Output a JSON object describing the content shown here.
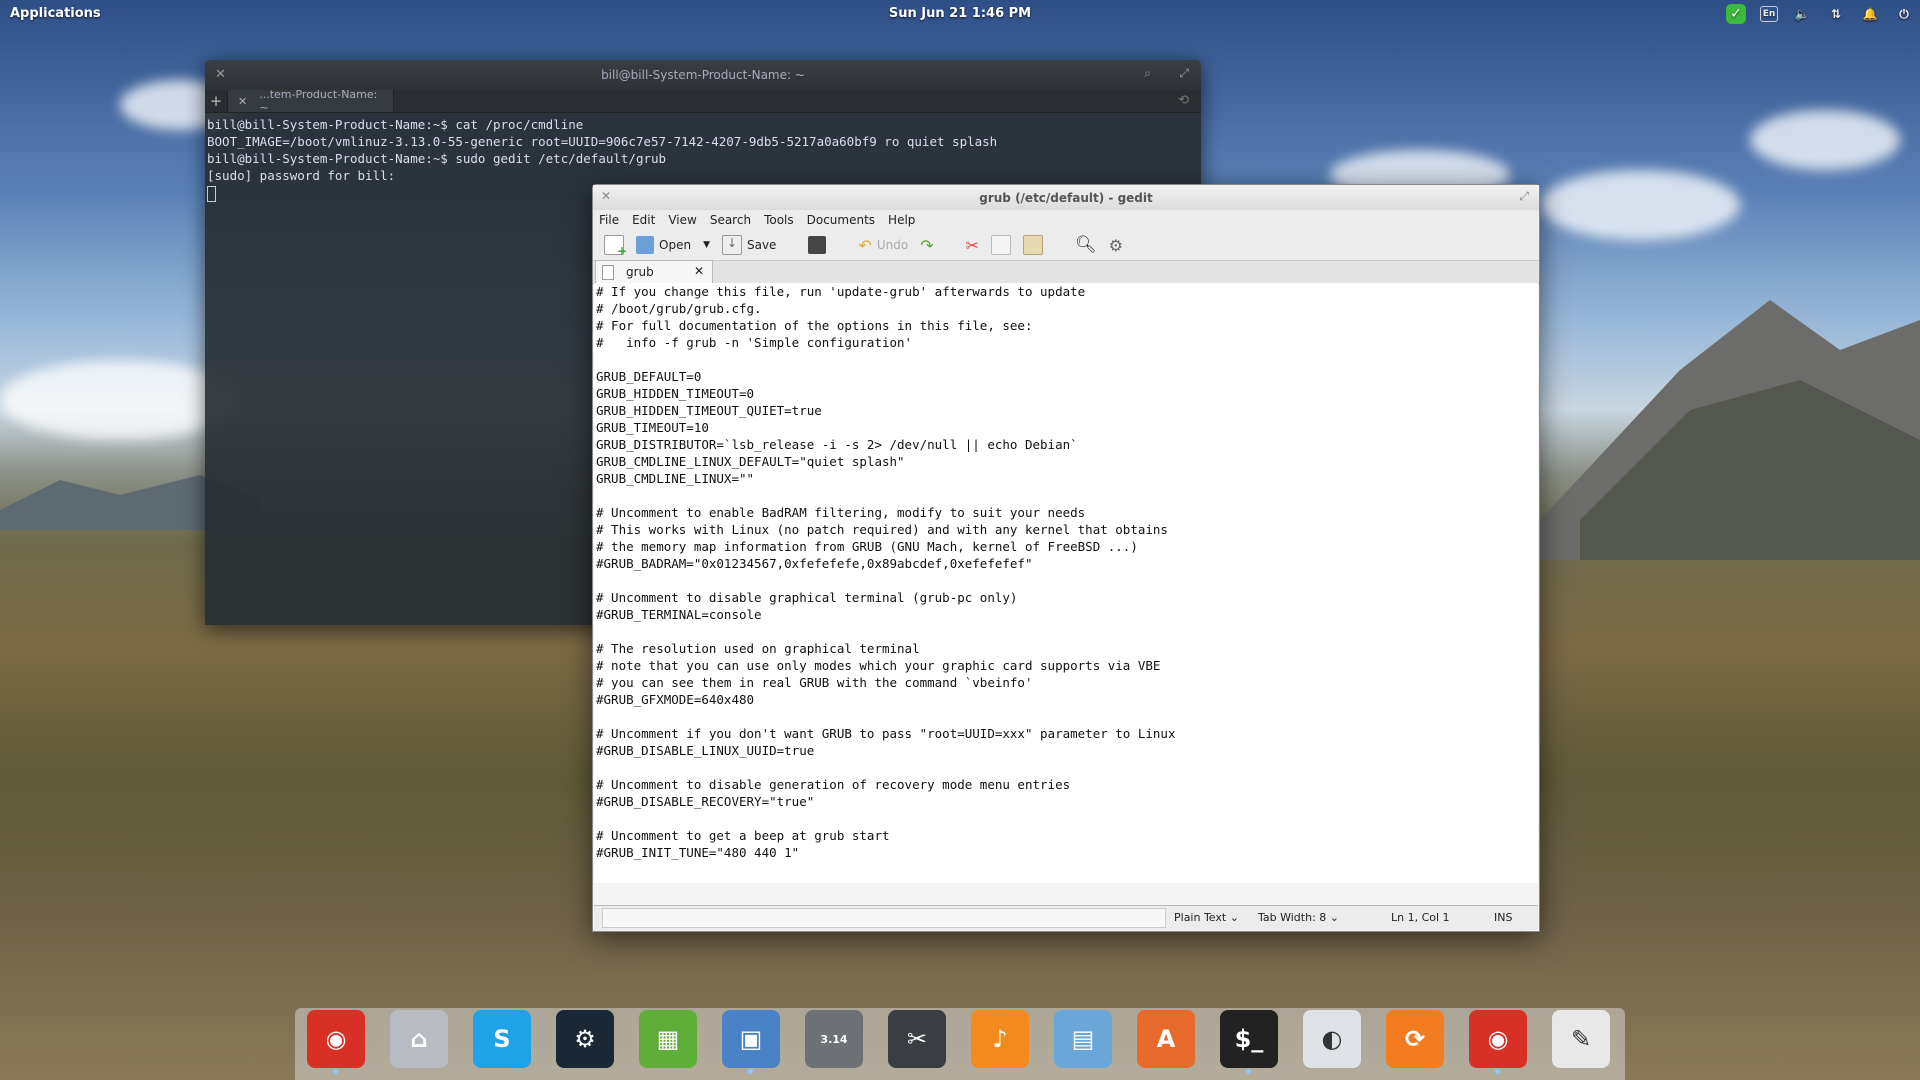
{
  "panel": {
    "applications_label": "Applications",
    "clock": "Sun Jun 21    1:46 PM",
    "tray": [
      "check-icon",
      "keyboard-lang-icon",
      "volume-icon",
      "network-icon",
      "notification-icon",
      "power-icon"
    ],
    "lang_label": "En"
  },
  "terminal": {
    "title": "bill@bill-System-Product-Name: ~",
    "tab_label": "...tem-Product-Name: ~",
    "lines": [
      "bill@bill-System-Product-Name:~$ cat /proc/cmdline",
      "BOOT_IMAGE=/boot/vmlinuz-3.13.0-55-generic root=UUID=906c7e57-7142-4207-9db5-5217a0a60bf9 ro quiet splash",
      "bill@bill-System-Product-Name:~$ sudo gedit /etc/default/grub",
      "[sudo] password for bill:"
    ]
  },
  "gedit": {
    "title": "grub (/etc/default) - gedit",
    "menu": [
      "File",
      "Edit",
      "View",
      "Search",
      "Tools",
      "Documents",
      "Help"
    ],
    "toolbar": {
      "open": "Open",
      "save": "Save",
      "undo": "Undo"
    },
    "tab_label": "grub",
    "text": "# If you change this file, run 'update-grub' afterwards to update\n# /boot/grub/grub.cfg.\n# For full documentation of the options in this file, see:\n#   info -f grub -n 'Simple configuration'\n\nGRUB_DEFAULT=0\nGRUB_HIDDEN_TIMEOUT=0\nGRUB_HIDDEN_TIMEOUT_QUIET=true\nGRUB_TIMEOUT=10\nGRUB_DISTRIBUTOR=`lsb_release -i -s 2> /dev/null || echo Debian`\nGRUB_CMDLINE_LINUX_DEFAULT=\"quiet splash\"\nGRUB_CMDLINE_LINUX=\"\"\n\n# Uncomment to enable BadRAM filtering, modify to suit your needs\n# This works with Linux (no patch required) and with any kernel that obtains\n# the memory map information from GRUB (GNU Mach, kernel of FreeBSD ...)\n#GRUB_BADRAM=\"0x01234567,0xfefefefe,0x89abcdef,0xefefefef\"\n\n# Uncomment to disable graphical terminal (grub-pc only)\n#GRUB_TERMINAL=console\n\n# The resolution used on graphical terminal\n# note that you can use only modes which your graphic card supports via VBE\n# you can see them in real GRUB with the command `vbeinfo'\n#GRUB_GFXMODE=640x480\n\n# Uncomment if you don't want GRUB to pass \"root=UUID=xxx\" parameter to Linux\n#GRUB_DISABLE_LINUX_UUID=true\n\n# Uncomment to disable generation of recovery mode menu entries\n#GRUB_DISABLE_RECOVERY=\"true\"\n\n# Uncomment to get a beep at grub start\n#GRUB_INIT_TUNE=\"480 440 1\"",
    "status": {
      "lang": "Plain Text",
      "tab_width": "Tab Width: 8",
      "position": "Ln 1, Col 1",
      "mode": "INS"
    }
  },
  "dock": {
    "items": [
      {
        "name": "chrome-icon",
        "color": "#d93025"
      },
      {
        "name": "files-icon",
        "color": "#b8bcc2"
      },
      {
        "name": "skype-icon",
        "color": "#1fa3e8"
      },
      {
        "name": "steam-icon",
        "color": "#1b2838"
      },
      {
        "name": "spreadsheet-icon",
        "color": "#5fae3a"
      },
      {
        "name": "image-viewer-icon",
        "color": "#4a82c8"
      },
      {
        "name": "calculator-icon",
        "color": "#6e7176"
      },
      {
        "name": "screenshot-icon",
        "color": "#3a3d42"
      },
      {
        "name": "music-icon",
        "color": "#f28a1e"
      },
      {
        "name": "photos-icon",
        "color": "#6aa7d8"
      },
      {
        "name": "app-center-icon",
        "color": "#e86a2a"
      },
      {
        "name": "terminal-icon",
        "color": "#222"
      },
      {
        "name": "switchboard-icon",
        "color": "#dfe3e8"
      },
      {
        "name": "software-update-icon",
        "color": "#f47c20"
      },
      {
        "name": "chrome-icon-2",
        "color": "#d93025"
      },
      {
        "name": "text-editor-icon",
        "color": "#e8e8e8"
      }
    ],
    "calc_label": "3.14"
  }
}
